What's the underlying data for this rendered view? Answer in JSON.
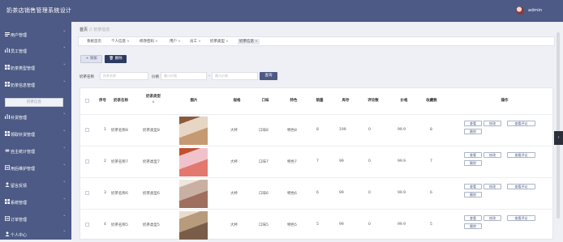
{
  "app": {
    "title": "奶茶店销售管理系统设计",
    "user": "admin"
  },
  "sidebar": {
    "items": [
      {
        "label": "用户管理",
        "chev": "˅"
      },
      {
        "label": "员工管理",
        "chev": "˅"
      },
      {
        "label": "奶茶类型管理",
        "chev": "˅"
      },
      {
        "label": "奶茶信息管理",
        "chev": "˄"
      },
      {
        "label": "补货管理",
        "chev": "˅"
      },
      {
        "label": "领取补货管理",
        "chev": "˅"
      },
      {
        "label": "自主统计管理",
        "chev": "˅"
      },
      {
        "label": "用后维护管理",
        "chev": "˅"
      },
      {
        "label": "留言反馈",
        "chev": "˅"
      },
      {
        "label": "系统管理",
        "chev": "˅"
      },
      {
        "label": "订单管理",
        "chev": "˅"
      },
      {
        "label": "个人中心",
        "chev": "˅"
      }
    ],
    "sub_item": "奶茶信息"
  },
  "breadcrumb": {
    "home": "首页",
    "sep": "//",
    "current": "奶茶信息"
  },
  "tabs": [
    {
      "label": "系统首页",
      "x": ""
    },
    {
      "label": "个人信息",
      "x": "×"
    },
    {
      "label": "修改密码",
      "x": "×"
    },
    {
      "label": "用户",
      "x": "×"
    },
    {
      "label": "员工",
      "x": "×"
    },
    {
      "label": "奶茶类型",
      "x": "×"
    },
    {
      "label": "奶茶信息",
      "x": "×"
    }
  ],
  "toolbar": {
    "add": "+ 添加",
    "delete": "🗑 删除"
  },
  "filters": {
    "name_label": "奶茶名称",
    "name_placeholder": "奶茶名称",
    "price_label": "价格",
    "min_placeholder": "最小价格",
    "to": "-",
    "max_placeholder": "最大价格",
    "search": "查询"
  },
  "table": {
    "headers": {
      "seq": "序号",
      "name": "奶茶名称",
      "type": "奶茶类型",
      "image": "图片",
      "size": "规格",
      "taste": "口味",
      "feature": "特色",
      "sales": "销量",
      "stock": "库存",
      "comments": "评论数",
      "price": "价格",
      "favorites": "收藏数",
      "actions": "操作"
    },
    "sort_icon": "⇅",
    "rows": [
      {
        "seq": "1",
        "name": "奶茶名称8",
        "type": "奶茶类型8",
        "size": "大杯",
        "taste": "口味8",
        "feature": "特色8",
        "sales": "8",
        "stock": "199",
        "comments": "0",
        "price": "99.9",
        "favorites": "8"
      },
      {
        "seq": "2",
        "name": "奶茶名称7",
        "type": "奶茶类型7",
        "size": "大杯",
        "taste": "口味7",
        "feature": "特色7",
        "sales": "7",
        "stock": "99",
        "comments": "0",
        "price": "99.9",
        "favorites": "7"
      },
      {
        "seq": "3",
        "name": "奶茶名称6",
        "type": "奶茶类型6",
        "size": "大杯",
        "taste": "口味6",
        "feature": "特色6",
        "sales": "6",
        "stock": "99",
        "comments": "0",
        "price": "99.9",
        "favorites": "6"
      },
      {
        "seq": "4",
        "name": "奶茶名称5",
        "type": "奶茶类型5",
        "size": "大杯",
        "taste": "口味5",
        "feature": "特色5",
        "sales": "5",
        "stock": "99",
        "comments": "0",
        "price": "99.9",
        "favorites": "5"
      }
    ],
    "row_buttons": {
      "view": "查看",
      "edit": "修改",
      "view_comments": "查看评论",
      "delete": "删除"
    }
  },
  "colors": {
    "sidebar": "#4d5a85",
    "primary_dark": "#2d3a61"
  }
}
